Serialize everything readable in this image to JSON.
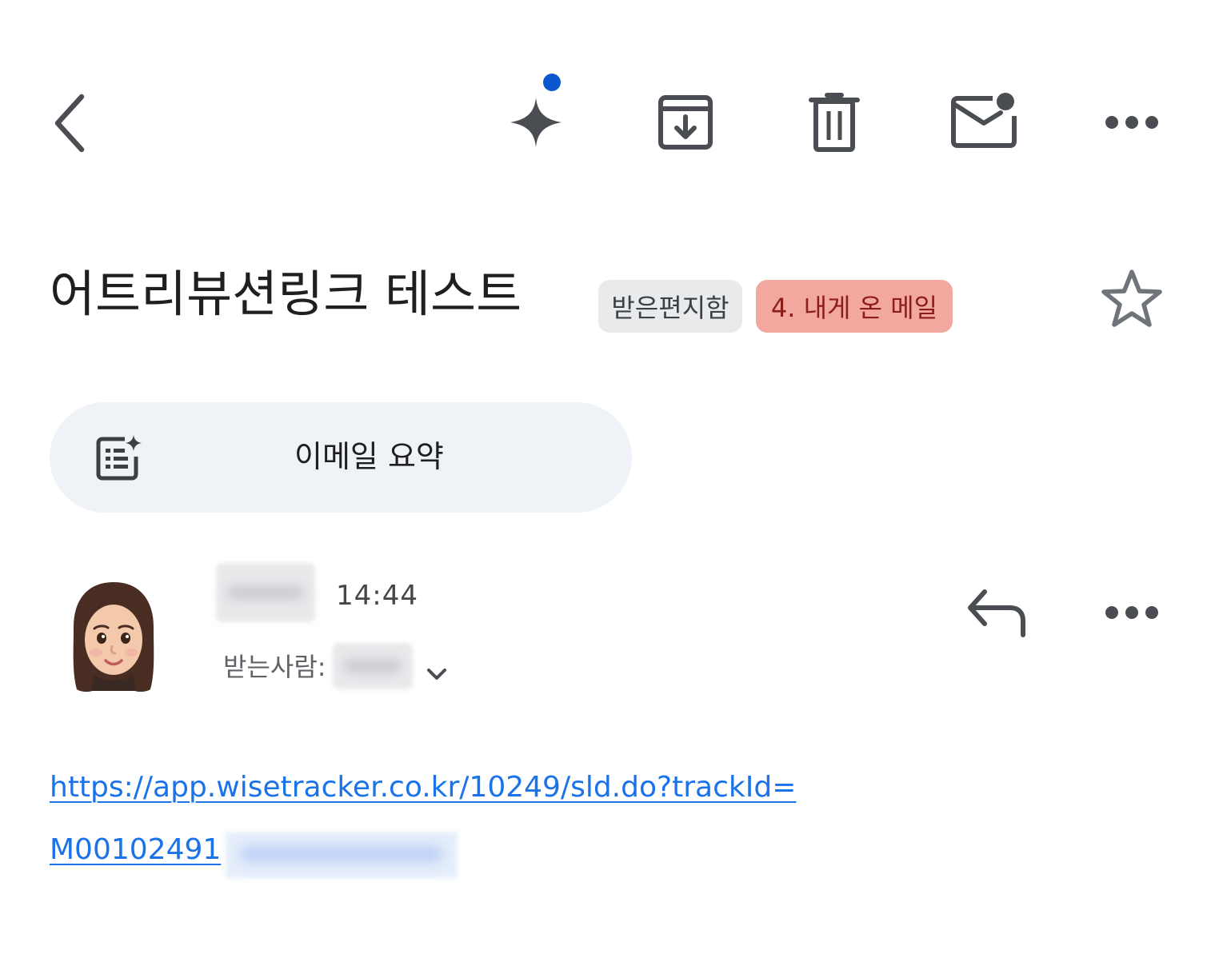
{
  "toolbar": {
    "icons": [
      "back-icon",
      "gemini-sparkle-icon",
      "archive-icon",
      "delete-icon",
      "mark-unread-icon",
      "more-icon"
    ],
    "accent_color": "#0b57d0"
  },
  "message": {
    "subject": "어트리뷰션링크 테스트",
    "labels": [
      {
        "text": "받은편지함",
        "bg": "#e9eaec",
        "fg": "#3c4043"
      },
      {
        "text": "4. 내게 온 메일",
        "bg": "#f2a89e",
        "fg": "#8c1d18"
      }
    ],
    "starred": false
  },
  "summary": {
    "label": "이메일 요약",
    "icon": "summarize-icon"
  },
  "sender": {
    "avatar": "memoji-avatar",
    "time": "14:44",
    "to_label": "받는사람:"
  },
  "body": {
    "link_line1": "https://app.wisetracker.co.kr/10249/sld.do?trackId=",
    "link_line2": "M00102491"
  }
}
